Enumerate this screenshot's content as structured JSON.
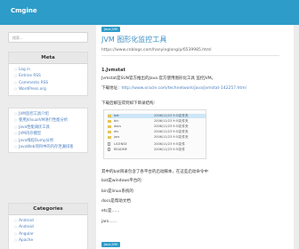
{
  "header": {
    "brand": "Cmgine"
  },
  "search": {
    "placeholder": "搜索..."
  },
  "meta": {
    "title": "Meta",
    "items": [
      "Log in",
      "Entries RSS",
      "Comments RSS",
      "WordPress.org"
    ]
  },
  "recent": {
    "items": [
      "JVM监控工具介绍",
      "使用JVisualVM进行性能分析",
      "Java性能调优工具",
      "JVM内存模型",
      "Java线程Dump分析",
      "JavaWeb项目中的内存泄漏排查"
    ]
  },
  "categories": {
    "title": "Categories",
    "items": [
      "Android",
      "Android",
      "Angular",
      "Apache"
    ]
  },
  "post": {
    "tag": "Java JVM",
    "title": "JVM 图形化监控工具",
    "url": "https://www.cnblogs.com/hanyinglong/p/6539985.html",
    "section": "1.Jvmstat",
    "line1": "Jvmstat是SUN官方推出的Java 官方使用图形化工具 监控JVM。",
    "line2_label": "下载地址：",
    "line2_link": "http://www.oracle.com/technetwork/java/jvmstat-142257.html",
    "line3": "下载后解压得到如下目录结构：",
    "files": [
      {
        "name": "bat",
        "date": "2006/11/23 9:51",
        "type": "文件夹"
      },
      {
        "name": "bin",
        "date": "2006/11/23 9:51",
        "type": "文件夹"
      },
      {
        "name": "docs",
        "date": "2006/11/23 9:51",
        "type": "文件夹"
      },
      {
        "name": "etc",
        "date": "2006/11/23 9:51",
        "type": "文件夹"
      },
      {
        "name": "jars",
        "date": "2006/11/23 9:51",
        "type": "文件夹"
      },
      {
        "name": "LICENSE",
        "date": "2006/11/23 9:51",
        "type": "文件"
      },
      {
        "name": "README",
        "date": "2006/11/23 9:51",
        "type": "文件"
      }
    ],
    "desc1": "其中的bat目录包含了各平台的启动脚本，在这些启动命令中",
    "desc2": "bat是windows平台的",
    "desc3": "bin是linux系统的",
    "desc4": "docs是帮助文档",
    "desc5": "etc是……",
    "desc6": "jars……",
    "tag2": "Java JVM"
  }
}
